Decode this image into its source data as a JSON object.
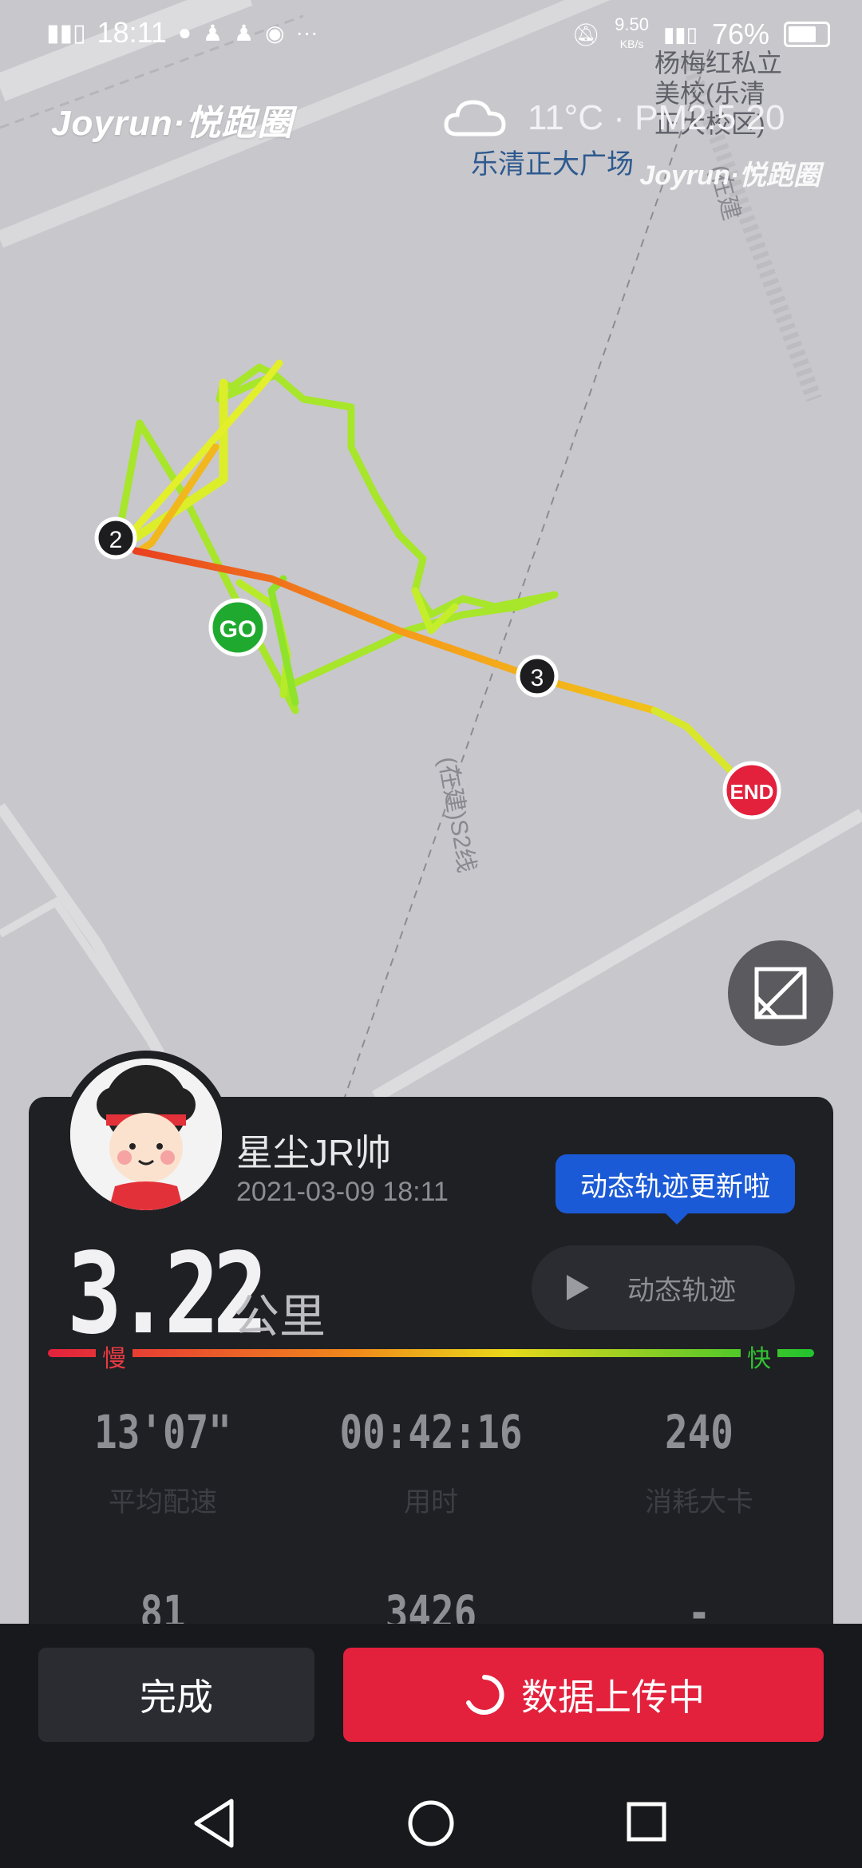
{
  "status_bar": {
    "time": "18:11",
    "net_speed": "9.50",
    "net_unit": "KB/s",
    "battery": "76%"
  },
  "map": {
    "brand": "Joyrun·悦跑圈",
    "brand_watermark": "Joyrun·悦跑圈",
    "weather": "11°C · PM2.5 20",
    "poi_label": "乐清正大广场",
    "poi_school": "杨梅红私立\n美校(乐清\n正大校区)",
    "road_label": "(在建)S2线",
    "road_label_2": "(在建",
    "markers": {
      "start": "GO",
      "end": "END",
      "km2": "2",
      "km3": "3"
    }
  },
  "card": {
    "username": "星尘JR帅",
    "date": "2021-03-09 18:11",
    "tooltip": "动态轨迹更新啦",
    "dynamic_button": "动态轨迹",
    "distance": "3.22",
    "distance_unit": "公里",
    "speed_slow": "慢",
    "speed_fast": "快",
    "stats": [
      {
        "value": "13'07\"",
        "label": "平均配速"
      },
      {
        "value": "00:42:16",
        "label": "用时"
      },
      {
        "value": "240",
        "label": "消耗大卡"
      },
      {
        "value": "81",
        "label": ""
      },
      {
        "value": "3426",
        "label": ""
      },
      {
        "value": "-",
        "label": ""
      }
    ]
  },
  "actions": {
    "done": "完成",
    "uploading": "数据上传中"
  },
  "colors": {
    "accent": "#e3213d",
    "tooltip": "#1b5ad6",
    "card_bg": "#1f2024",
    "slow": "#e83b43",
    "fast": "#32c332"
  }
}
